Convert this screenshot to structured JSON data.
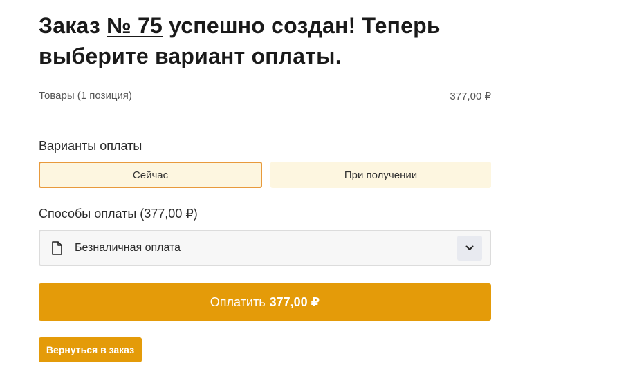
{
  "header": {
    "title_prefix": "Заказ",
    "order_number": "№ 75",
    "title_suffix_line1": "успешно создан! Теперь",
    "title_line2": "выберите вариант оплаты."
  },
  "summary": {
    "items_label": "Товары (1 позиция)",
    "items_total": "377,00 ₽"
  },
  "payment_variants": {
    "label": "Варианты оплаты",
    "options": [
      "Сейчас",
      "При получении"
    ],
    "selected": "Сейчас"
  },
  "payment_methods": {
    "label": "Способы оплаты (377,00 ₽)",
    "selected_value": "Безналичная оплата",
    "icon": "document-icon"
  },
  "pay_button": {
    "label": "Оплатить",
    "amount": "377,00 ₽"
  },
  "back_button": {
    "label": "Вернуться в заказ"
  },
  "colors": {
    "accent": "#e49b09",
    "active_border": "#e89a3c",
    "tab_bg": "#fdf6e0"
  }
}
